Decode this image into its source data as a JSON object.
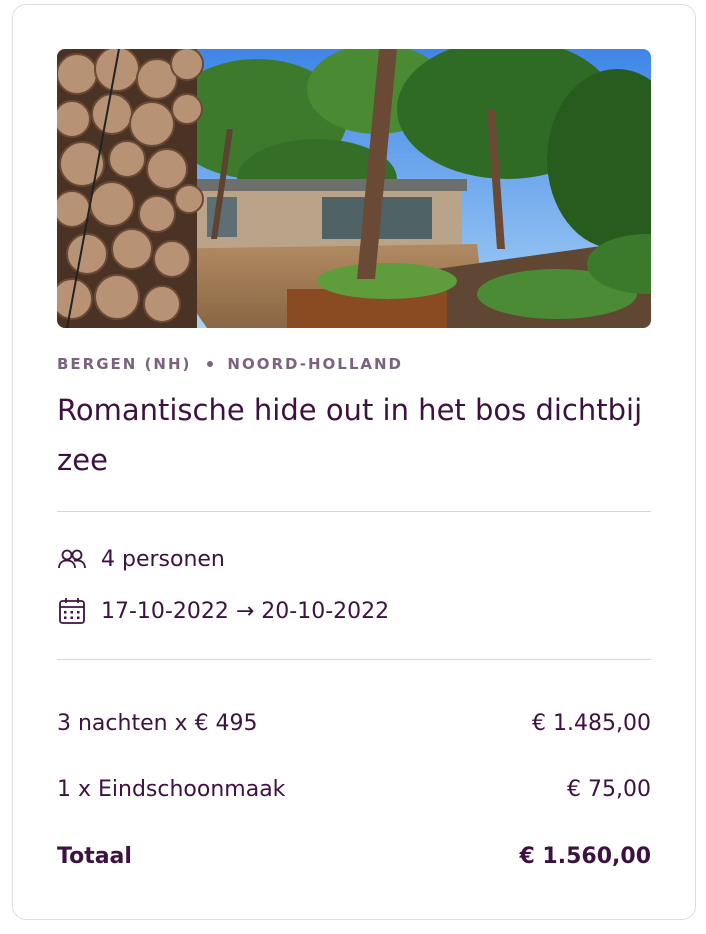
{
  "listing": {
    "location_city": "BERGEN (NH)",
    "location_region": "NOORD-HOLLAND",
    "title": "Romantische hide out in het bos dichtbij zee",
    "guests": "4 personen",
    "dates": "17-10-2022 → 20-10-2022",
    "photo_icon": "forest-house-photo"
  },
  "pricing": {
    "rows": [
      {
        "label": "3 nachten x € 495",
        "amount": "€ 1.485,00"
      },
      {
        "label": "1 x Eindschoonmaak",
        "amount": "€ 75,00"
      }
    ],
    "total_label": "Totaal",
    "total_amount": "€ 1.560,00"
  },
  "colors": {
    "primary": "#3d1240",
    "muted": "#7d6280",
    "divider": "#d8d5d9",
    "border": "#dedcdf"
  }
}
